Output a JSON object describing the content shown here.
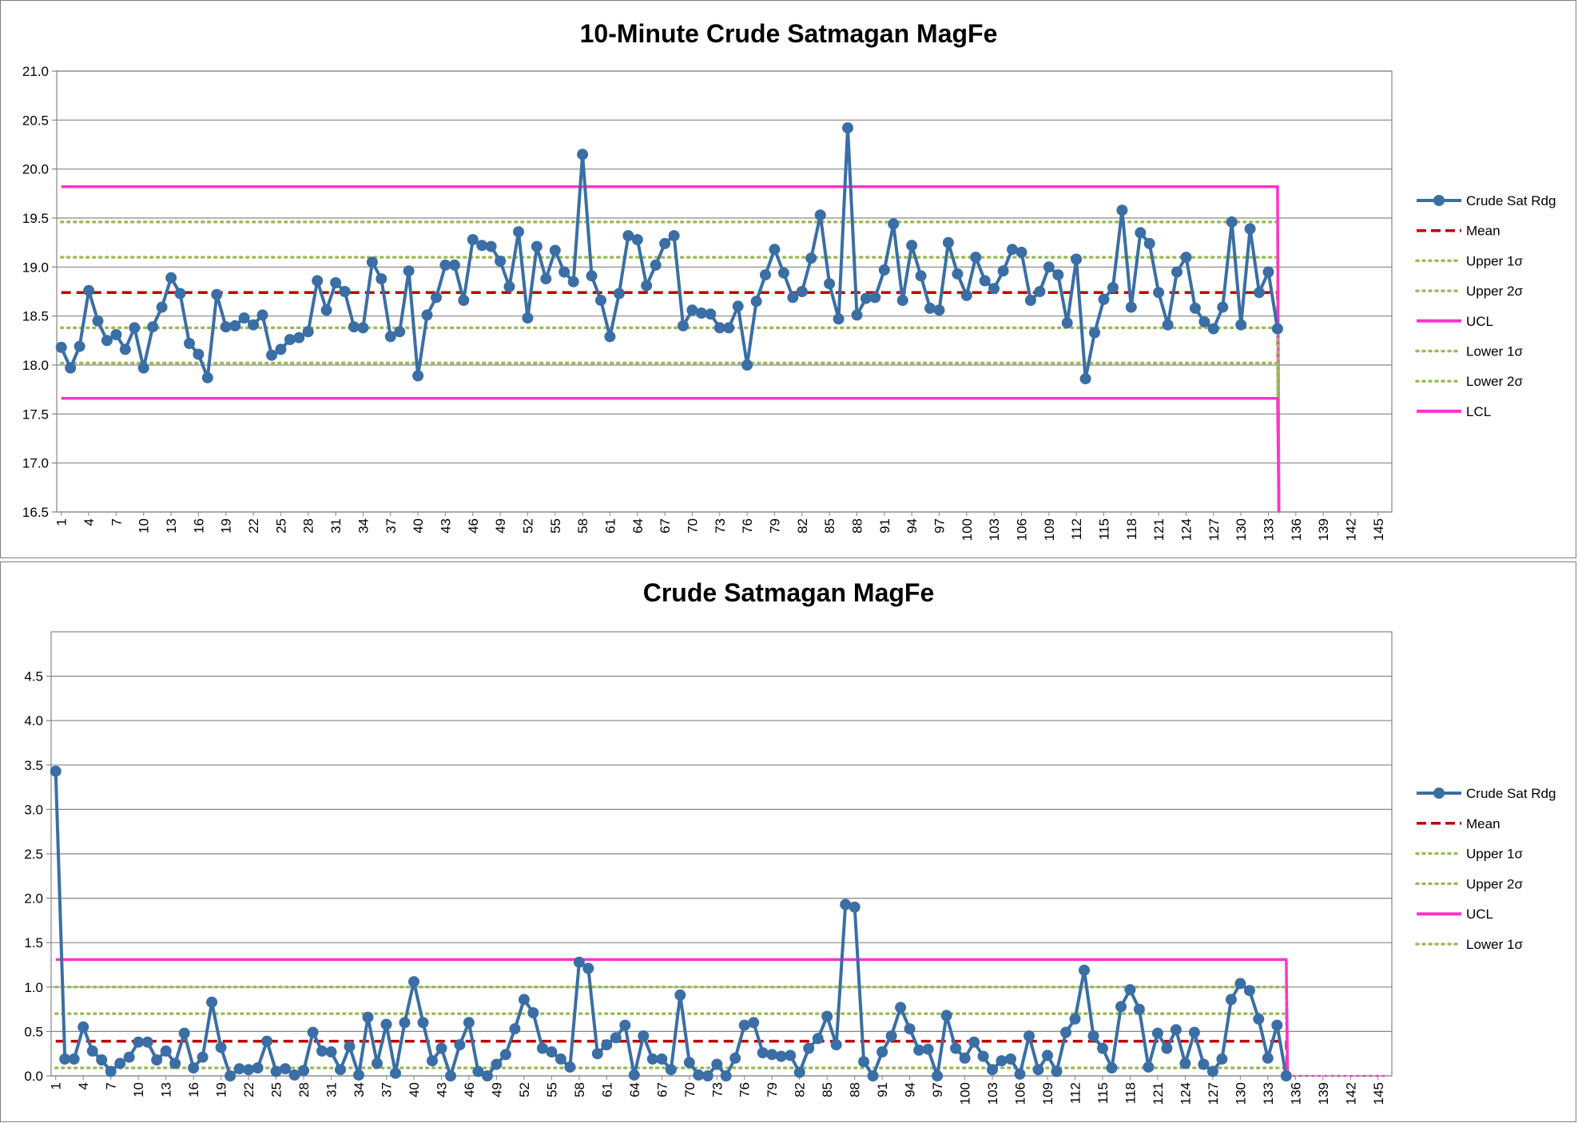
{
  "charts": [
    {
      "title": "10-Minute Crude Satmagan MagFe",
      "legend": [
        "Crude Sat Rdg",
        "Mean",
        "Upper 1σ",
        "Upper 2σ",
        "UCL",
        "Lower 1σ",
        "Lower 2σ",
        "LCL"
      ]
    },
    {
      "title": "Crude Satmagan MagFe",
      "legend": [
        "Crude Sat Rdg",
        "Mean",
        "Upper 1σ",
        "Upper 2σ",
        "UCL",
        "Lower 1σ"
      ]
    }
  ],
  "chart_data": [
    {
      "type": "line",
      "title": "10-Minute Crude Satmagan MagFe",
      "x_range": [
        1,
        146
      ],
      "ylim": [
        16.5,
        21.0
      ],
      "y_ticks": [
        "16.5",
        "17.0",
        "17.5",
        "18.0",
        "18.5",
        "19.0",
        "19.5",
        "20.0",
        "20.5",
        "21.0"
      ],
      "x_ticks": [
        "1",
        "4",
        "7",
        "10",
        "13",
        "16",
        "19",
        "22",
        "25",
        "28",
        "31",
        "34",
        "37",
        "40",
        "43",
        "46",
        "49",
        "52",
        "55",
        "58",
        "61",
        "64",
        "67",
        "70",
        "73",
        "76",
        "79",
        "82",
        "85",
        "88",
        "91",
        "94",
        "97",
        "100",
        "103",
        "106",
        "109",
        "112",
        "115",
        "118",
        "121",
        "124",
        "127",
        "130",
        "133",
        "136",
        "139",
        "142",
        "145"
      ],
      "grid": true,
      "legend_position": "right",
      "series": [
        {
          "name": "Crude Sat Rdg",
          "color": "#3a6ea5",
          "style": "line-marker",
          "values": [
            18.18,
            17.97,
            18.19,
            18.76,
            18.45,
            18.25,
            18.31,
            18.16,
            18.38,
            17.97,
            18.39,
            18.59,
            18.89,
            18.73,
            18.22,
            18.11,
            17.87,
            18.72,
            18.39,
            18.4,
            18.48,
            18.41,
            18.51,
            18.1,
            18.16,
            18.26,
            18.28,
            18.34,
            18.86,
            18.56,
            18.84,
            18.75,
            18.39,
            18.38,
            19.05,
            18.88,
            18.29,
            18.34,
            18.96,
            17.89,
            18.51,
            18.69,
            19.02,
            19.02,
            18.66,
            19.28,
            19.22,
            19.21,
            19.06,
            18.8,
            19.36,
            18.48,
            19.21,
            18.88,
            19.17,
            18.95,
            18.85,
            20.15,
            18.91,
            18.66,
            18.29,
            18.73,
            19.32,
            19.28,
            18.81,
            19.02,
            19.24,
            19.32,
            18.4,
            18.56,
            18.53,
            18.52,
            18.38,
            18.38,
            18.6,
            18.0,
            18.65,
            18.92,
            19.18,
            18.94,
            18.69,
            18.75,
            19.09,
            19.53,
            18.83,
            18.47,
            20.42,
            18.51,
            18.68,
            18.69,
            18.97,
            19.44,
            18.66,
            19.22,
            18.91,
            18.58,
            18.56,
            19.25,
            18.93,
            18.71,
            19.1,
            18.86,
            18.78,
            18.96,
            19.18,
            19.15,
            18.66,
            18.75,
            19.0,
            18.92,
            18.43,
            19.08,
            17.86,
            18.33,
            18.67,
            18.79,
            19.58,
            18.59,
            19.35,
            19.24,
            18.74,
            18.41,
            18.95,
            19.1,
            18.58,
            18.44,
            18.37,
            18.59,
            19.46,
            18.41,
            19.39,
            18.74,
            18.95,
            18.37
          ]
        },
        {
          "name": "Mean",
          "color": "#c00000",
          "style": "dashed",
          "values": [
            18.74
          ]
        },
        {
          "name": "Upper 1σ",
          "color": "#9bbb59",
          "style": "dotted",
          "values": [
            19.1
          ]
        },
        {
          "name": "Upper 2σ",
          "color": "#9bbb59",
          "style": "dotted",
          "values": [
            19.46
          ]
        },
        {
          "name": "UCL",
          "color": "#ff33cc",
          "style": "solid",
          "values": [
            19.82
          ]
        },
        {
          "name": "Lower 1σ",
          "color": "#9bbb59",
          "style": "dotted",
          "values": [
            18.38
          ]
        },
        {
          "name": "Lower 2σ",
          "color": "#9bbb59",
          "style": "dotted",
          "values": [
            18.02
          ]
        },
        {
          "name": "LCL",
          "color": "#ff33cc",
          "style": "solid",
          "values": [
            17.66
          ]
        }
      ]
    },
    {
      "type": "line",
      "title": "Crude Satmagan MagFe",
      "x_range": [
        1,
        146
      ],
      "ylim": [
        0.0,
        5.0
      ],
      "y_ticks": [
        "0.0",
        "0.5",
        "1.0",
        "1.5",
        "2.0",
        "2.5",
        "3.0",
        "3.5",
        "4.0",
        "4.5"
      ],
      "x_ticks": [
        "1",
        "4",
        "7",
        "10",
        "13",
        "16",
        "19",
        "22",
        "25",
        "28",
        "31",
        "34",
        "37",
        "40",
        "43",
        "46",
        "49",
        "52",
        "55",
        "58",
        "61",
        "64",
        "67",
        "70",
        "73",
        "76",
        "79",
        "82",
        "85",
        "88",
        "91",
        "94",
        "97",
        "100",
        "103",
        "106",
        "109",
        "112",
        "115",
        "118",
        "121",
        "124",
        "127",
        "130",
        "133",
        "136",
        "139",
        "142",
        "145"
      ],
      "grid": true,
      "legend_position": "right",
      "series": [
        {
          "name": "Crude Sat Rdg",
          "color": "#3a6ea5",
          "style": "line-marker",
          "values": [
            3.43,
            0.19,
            0.19,
            0.55,
            0.28,
            0.18,
            0.05,
            0.14,
            0.21,
            0.38,
            0.38,
            0.18,
            0.28,
            0.14,
            0.48,
            0.09,
            0.21,
            0.83,
            0.32,
            0.0,
            0.08,
            0.07,
            0.09,
            0.39,
            0.05,
            0.08,
            0.01,
            0.06,
            0.49,
            0.28,
            0.27,
            0.07,
            0.33,
            0.01,
            0.66,
            0.14,
            0.58,
            0.03,
            0.6,
            1.06,
            0.6,
            0.17,
            0.31,
            0.0,
            0.35,
            0.6,
            0.05,
            0.0,
            0.13,
            0.24,
            0.53,
            0.86,
            0.71,
            0.31,
            0.27,
            0.19,
            0.1,
            1.28,
            1.21,
            0.25,
            0.35,
            0.43,
            0.57,
            0.01,
            0.45,
            0.19,
            0.19,
            0.07,
            0.91,
            0.15,
            0.01,
            0.0,
            0.13,
            0.0,
            0.2,
            0.57,
            0.6,
            0.26,
            0.24,
            0.22,
            0.23,
            0.04,
            0.31,
            0.42,
            0.67,
            0.35,
            1.93,
            1.9,
            0.16,
            0.0,
            0.27,
            0.45,
            0.77,
            0.53,
            0.29,
            0.3,
            0.0,
            0.68,
            0.31,
            0.2,
            0.38,
            0.22,
            0.07,
            0.17,
            0.19,
            0.02,
            0.45,
            0.07,
            0.23,
            0.05,
            0.49,
            0.64,
            1.19,
            0.45,
            0.31,
            0.09,
            0.78,
            0.97,
            0.75,
            0.1,
            0.48,
            0.31,
            0.52,
            0.14,
            0.49,
            0.13,
            0.05,
            0.19,
            0.86,
            1.04,
            0.96,
            0.64,
            0.2,
            0.57,
            0.0
          ]
        },
        {
          "name": "Mean",
          "color": "#c00000",
          "style": "dashed",
          "values": [
            0.39
          ]
        },
        {
          "name": "Upper 1σ",
          "color": "#9bbb59",
          "style": "dotted",
          "values": [
            0.7
          ]
        },
        {
          "name": "Upper 2σ",
          "color": "#9bbb59",
          "style": "dotted",
          "values": [
            1.0
          ]
        },
        {
          "name": "UCL",
          "color": "#ff33cc",
          "style": "solid",
          "values": [
            1.31
          ]
        },
        {
          "name": "Lower 1σ",
          "color": "#9bbb59",
          "style": "dotted",
          "values": [
            0.09
          ]
        }
      ]
    }
  ]
}
